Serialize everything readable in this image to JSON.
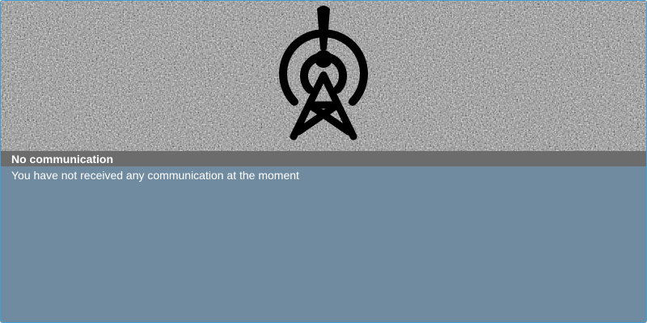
{
  "panel": {
    "title": "No communication",
    "message": "You have not received any communication at the moment",
    "icon": "radio-tower-alert-icon",
    "background": "tv-static-noise"
  },
  "colors": {
    "frame_border": "#3f9fd8",
    "body_background": "#708aa0",
    "title_bar": "#6c6c6c",
    "text": "#ffffff",
    "icon": "#000000"
  }
}
